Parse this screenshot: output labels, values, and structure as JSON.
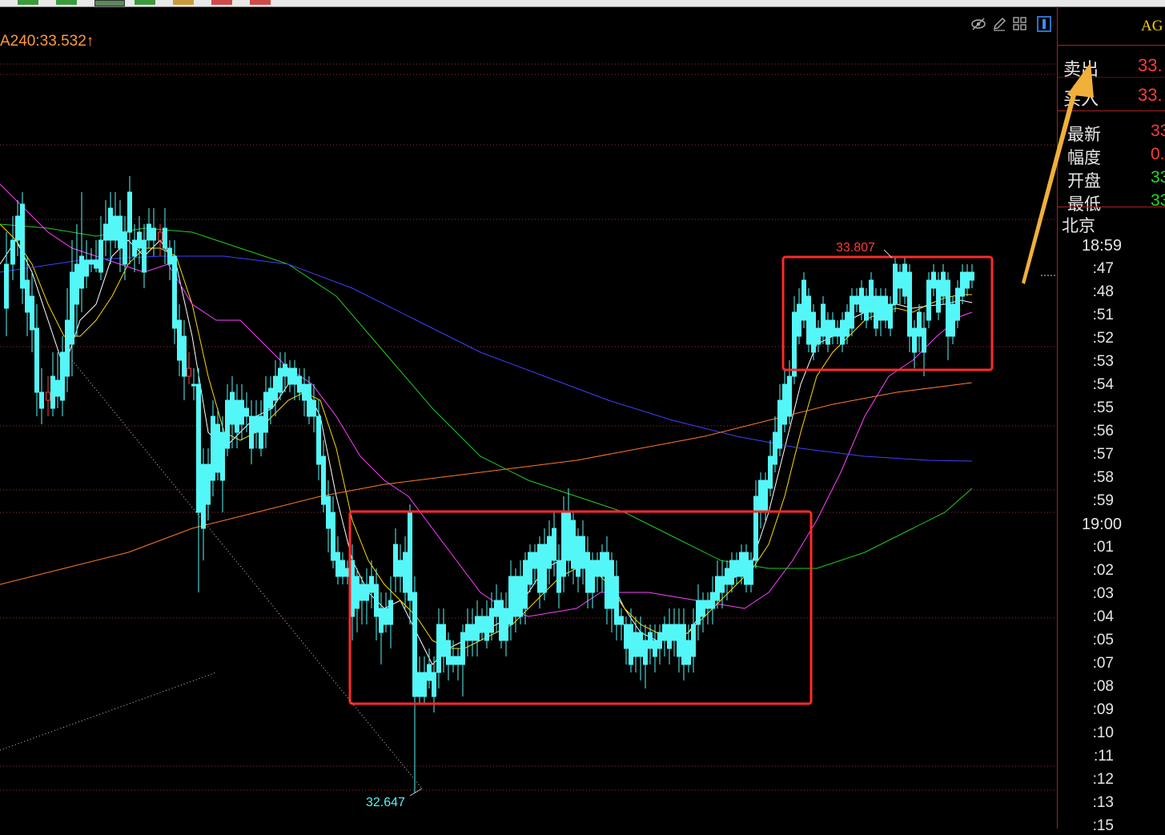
{
  "ma_label": "A240:33.532↑",
  "symbol": "AG",
  "quote": {
    "sell_label": "卖出",
    "sell_value": "33.",
    "buy_label": "买入",
    "buy_value": "33."
  },
  "info": [
    {
      "label": "最新",
      "value": "33",
      "color": "#ff3b3b"
    },
    {
      "label": "幅度",
      "value": "0.",
      "color": "#ff3b3b"
    },
    {
      "label": "开盘",
      "value": "33",
      "color": "#22dd22"
    },
    {
      "label": "最低",
      "value": "33",
      "color": "#22dd22"
    }
  ],
  "city": "北京",
  "time_ticks": [
    "18:59",
    ":47",
    ":48",
    ":51",
    ":52",
    ":53",
    ":54",
    ":55",
    ":56",
    ":57",
    ":58",
    ":59",
    "19:00",
    ":01",
    ":02",
    ":03",
    ":04",
    ":05",
    ":07",
    ":08",
    ":09",
    ":10",
    ":11",
    ":12",
    ":13",
    ":15"
  ],
  "colors": {
    "up": "#ff3b3b",
    "down": "#54f7f7",
    "box": "#ff2a2a",
    "arrow": "#f0b03a"
  },
  "toolbar_icons": [
    "eye-hide-icon",
    "pencil-icon",
    "grid-icon",
    "grid-alt-icon",
    "panel-icon"
  ],
  "chart_data": {
    "type": "candlestick",
    "high_label": "33.807",
    "low_label": "32.647",
    "high": 33.807,
    "low": 32.647,
    "series": [
      {
        "name": "A240",
        "last": 33.532
      }
    ]
  }
}
